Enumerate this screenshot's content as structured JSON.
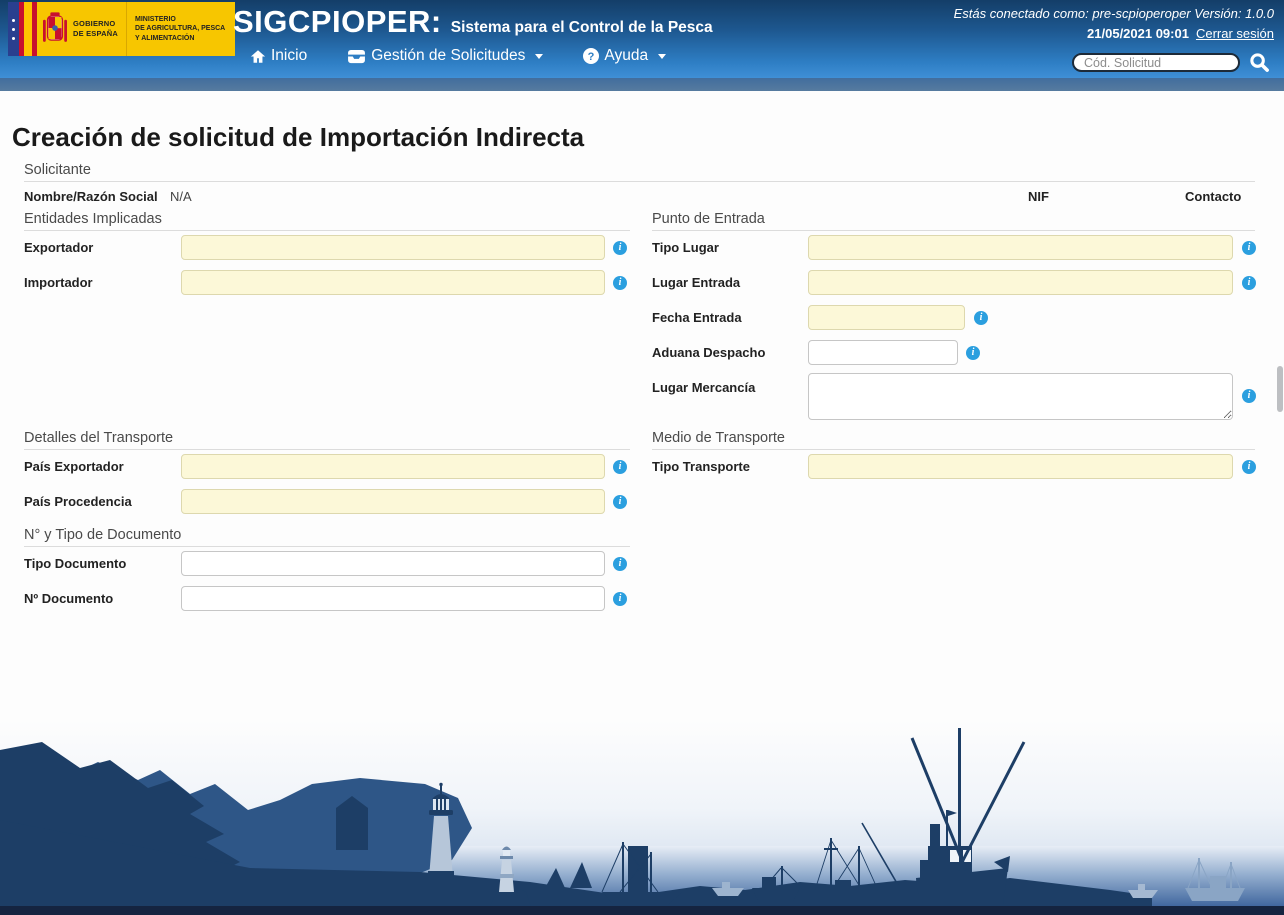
{
  "colors": {
    "header_top": "#143e68",
    "header_bottom": "#3f8fd6",
    "substrip": "#4d7499",
    "accent_info_blue": "#2b9fdf",
    "required_field_bg": "#fcf8d8",
    "logo_yellow": "#f7c600",
    "silhouette_navy": "#1d3e66",
    "silhouette_mid_blue": "#2e5687",
    "silhouette_light_blue": "#8aa5c5"
  },
  "header": {
    "logo": {
      "gobierno_line1": "GOBIERNO",
      "gobierno_line2": "DE ESPAÑA",
      "ministerio_line1": "MINISTERIO",
      "ministerio_line2": "DE AGRICULTURA, PESCA",
      "ministerio_line3": "Y ALIMENTACIÓN"
    },
    "app_name": "SIGCPIOPER:",
    "app_tagline": "Sistema para el Control de la Pesca",
    "session_text": "Estás conectado como: pre-scpioperoper Versión: 1.0.0",
    "datetime": "21/05/2021 09:01",
    "logout_label": "Cerrar sesión",
    "nav": [
      {
        "label": "Inicio",
        "icon": "home-icon",
        "has_dropdown": false
      },
      {
        "label": "Gestión de Solicitudes",
        "icon": "inbox-icon",
        "has_dropdown": true
      },
      {
        "label": "Ayuda",
        "icon": "help-icon",
        "has_dropdown": true
      }
    ],
    "search_placeholder": "Cód. Solicitud"
  },
  "page": {
    "title": "Creación de solicitud de Importación Indirecta",
    "solicitante": {
      "title": "Solicitante",
      "nombre_label": "Nombre/Razón Social",
      "nombre_value": "N/A",
      "nif_label": "NIF",
      "contacto_label": "Contacto"
    },
    "entidades": {
      "title": "Entidades Implicadas",
      "fields": [
        {
          "label": "Exportador",
          "value": "",
          "required": true
        },
        {
          "label": "Importador",
          "value": "",
          "required": true
        }
      ]
    },
    "punto_entrada": {
      "title": "Punto de Entrada",
      "fields": [
        {
          "label": "Tipo Lugar",
          "value": "",
          "required": true
        },
        {
          "label": "Lugar Entrada",
          "value": "",
          "required": true
        },
        {
          "label": "Fecha Entrada",
          "value": "",
          "required": true
        },
        {
          "label": "Aduana Despacho",
          "value": "",
          "required": false
        },
        {
          "label": "Lugar Mercancía",
          "value": "",
          "required": false
        }
      ]
    },
    "detalles_transporte": {
      "title": "Detalles del Transporte",
      "fields": [
        {
          "label": "País Exportador",
          "value": "",
          "required": true
        },
        {
          "label": "País Procedencia",
          "value": "",
          "required": true
        }
      ]
    },
    "medio_transporte": {
      "title": "Medio de Transporte",
      "fields": [
        {
          "label": "Tipo Transporte",
          "value": "",
          "required": true
        }
      ]
    },
    "documento": {
      "title": "N° y Tipo de Documento",
      "fields": [
        {
          "label": "Tipo Documento",
          "value": "",
          "required": false
        },
        {
          "label": "Nº Documento",
          "value": "",
          "required": false
        }
      ]
    }
  }
}
